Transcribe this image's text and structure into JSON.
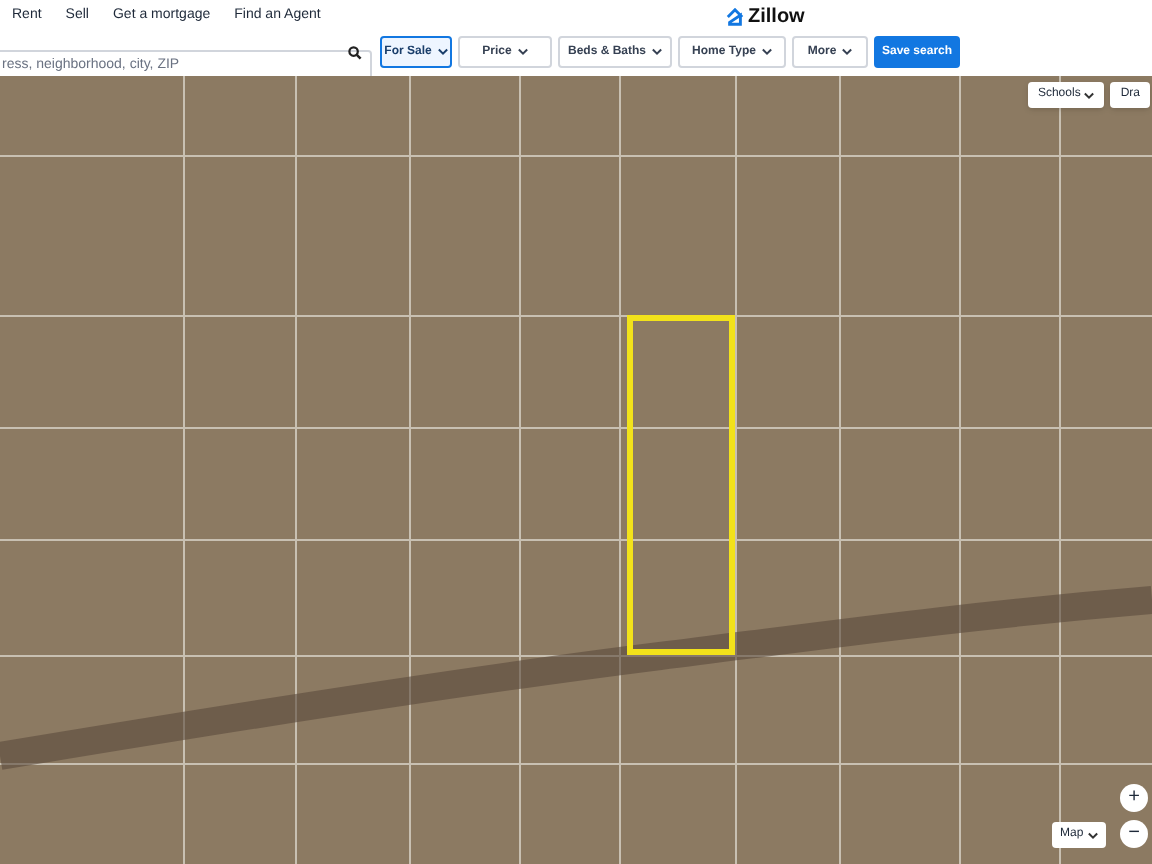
{
  "nav": {
    "links": [
      "Rent",
      "Sell",
      "Get a mortgage",
      "Find an Agent"
    ],
    "logo": "Zillow"
  },
  "search": {
    "placeholder": "ress, neighborhood, city, ZIP"
  },
  "filters": [
    {
      "label": "For Sale",
      "selected": true
    },
    {
      "label": "Price",
      "selected": false
    },
    {
      "label": "Beds & Baths",
      "selected": false
    },
    {
      "label": "Home Type",
      "selected": false
    },
    {
      "label": "More",
      "selected": false
    }
  ],
  "save_button": "Save search",
  "map": {
    "overlay_buttons": [
      "Schools",
      "Dra"
    ],
    "map_type": "Map",
    "zoom_in": "+",
    "zoom_out": "−"
  }
}
